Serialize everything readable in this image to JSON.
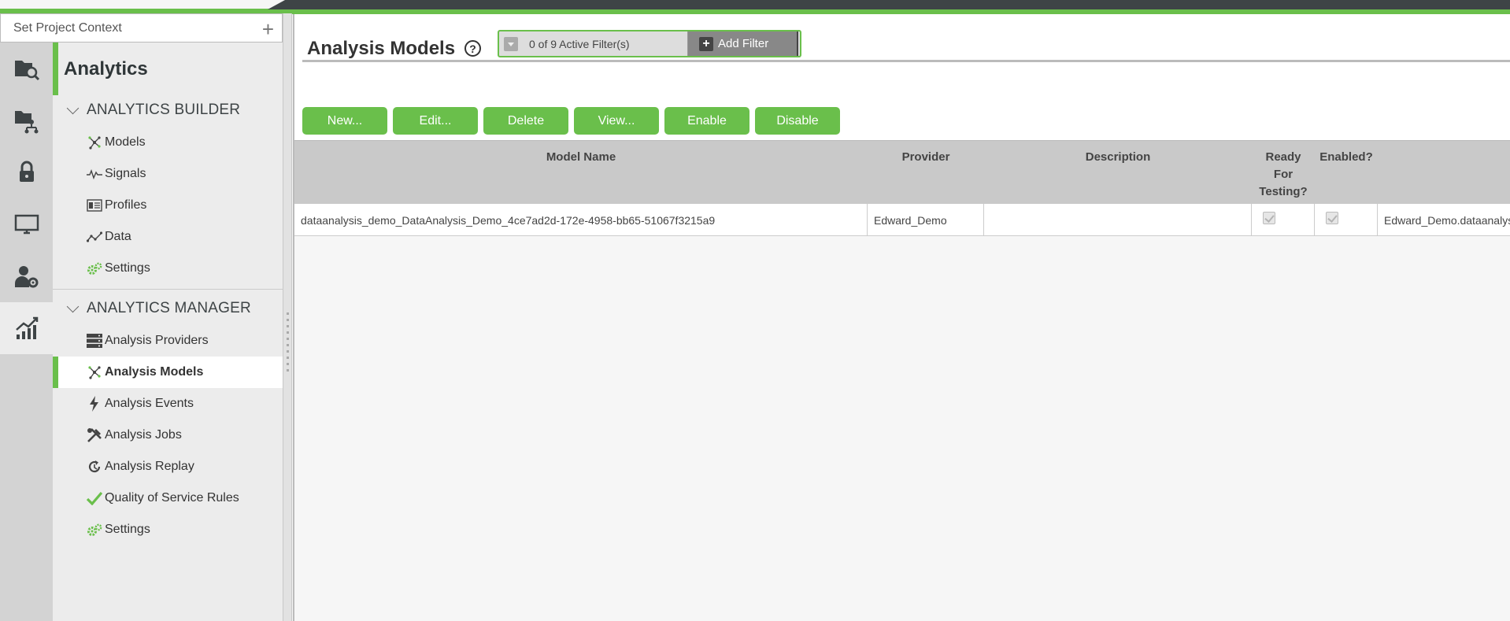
{
  "project_context": {
    "placeholder": "Set Project Context",
    "add_icon": "plus-icon"
  },
  "rail": [
    {
      "icon": "folder-search-icon"
    },
    {
      "icon": "folder-tree-icon"
    },
    {
      "icon": "lock-icon"
    },
    {
      "icon": "monitor-icon"
    },
    {
      "icon": "user-gear-icon"
    },
    {
      "icon": "analytics-chart-icon"
    }
  ],
  "nav": {
    "title": "Analytics",
    "builder": {
      "label": "ANALYTICS BUILDER",
      "items": [
        {
          "label": "Models",
          "icon": "model-network-icon"
        },
        {
          "label": "Signals",
          "icon": "signal-wave-icon"
        },
        {
          "label": "Profiles",
          "icon": "profile-card-icon"
        },
        {
          "label": "Data",
          "icon": "data-line-icon"
        },
        {
          "label": "Settings",
          "icon": "gears-icon"
        }
      ]
    },
    "manager": {
      "label": "ANALYTICS MANAGER",
      "items": [
        {
          "label": "Analysis Providers",
          "icon": "server-stack-icon"
        },
        {
          "label": "Analysis Models",
          "icon": "model-network-icon"
        },
        {
          "label": "Analysis Events",
          "icon": "lightning-icon"
        },
        {
          "label": "Analysis Jobs",
          "icon": "tools-icon"
        },
        {
          "label": "Analysis Replay",
          "icon": "replay-icon"
        },
        {
          "label": "Quality of Service Rules",
          "icon": "checkmark-icon"
        },
        {
          "label": "Settings",
          "icon": "gears-icon"
        }
      ]
    }
  },
  "main": {
    "title": "Analysis Models",
    "filter": {
      "status": "0 of 9 Active Filter(s)",
      "add_label": "Add Filter"
    },
    "toolbar": {
      "new": "New...",
      "edit": "Edit...",
      "delete": "Delete",
      "view": "View...",
      "enable": "Enable",
      "disable": "Disable"
    },
    "table": {
      "headers": {
        "name": "Model Name",
        "provider": "Provider",
        "description": "Description",
        "ready_1": "Ready",
        "ready_2": "For",
        "ready_3": "Testing?",
        "enabled": "Enabled?"
      },
      "rows": [
        {
          "name": "dataanalysis_demo_DataAnalysis_Demo_4ce7ad2d-172e-4958-bb65-51067f3215a9",
          "provider": "Edward_Demo",
          "description": "",
          "ready": true,
          "enabled": true,
          "extra": "Edward_Demo.dataanalysis_demo"
        }
      ]
    }
  },
  "colors": {
    "accent": "#6abf4b",
    "dark": "#3e4446",
    "rail": "#d3d3d3"
  }
}
